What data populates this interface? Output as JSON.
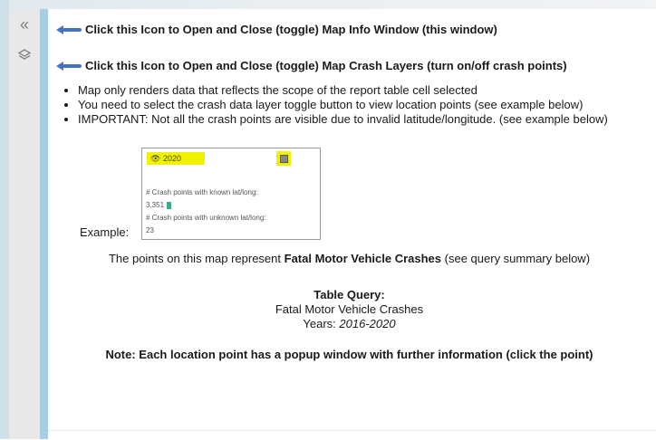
{
  "rail": {
    "collapse_icon": "double-chevron-left-icon",
    "layers_icon": "layers-icon"
  },
  "hints": {
    "info_window": "Click this Icon to Open and Close (toggle) Map Info Window (this window)",
    "crash_layers": "Click this Icon to Open and Close (toggle) Map Crash Layers (turn on/off crash points)"
  },
  "bullets": [
    "Map only renders data that reflects the scope of the report table cell selected",
    "You need to select the crash data layer toggle button to view location points (see example below)",
    "IMPORTANT: Not all the crash points are visible due to invalid latitude/longitude. (see example below)"
  ],
  "example": {
    "label": "Example:",
    "layer_year": "2020",
    "known_label": "# Crash points with known lat/long:",
    "known_count": "3,351",
    "unknown_label": "# Crash points with unknown lat/long:",
    "unknown_count": "23"
  },
  "summary": {
    "prefix": "The points on this map represent ",
    "emphasis": "Fatal Motor Vehicle Crashes",
    "suffix": " (see query summary below)"
  },
  "query": {
    "heading": "Table Query:",
    "name": "Fatal Motor Vehicle Crashes",
    "years_label": "Years: ",
    "years_value": "2016-2020"
  },
  "note": "Note: Each location point has a popup window with further information (click the point)",
  "colors": {
    "arrow": "#4472c4",
    "highlight": "#f2f200",
    "bar": "#3aaa8c",
    "side_band": "#a9cde2"
  }
}
